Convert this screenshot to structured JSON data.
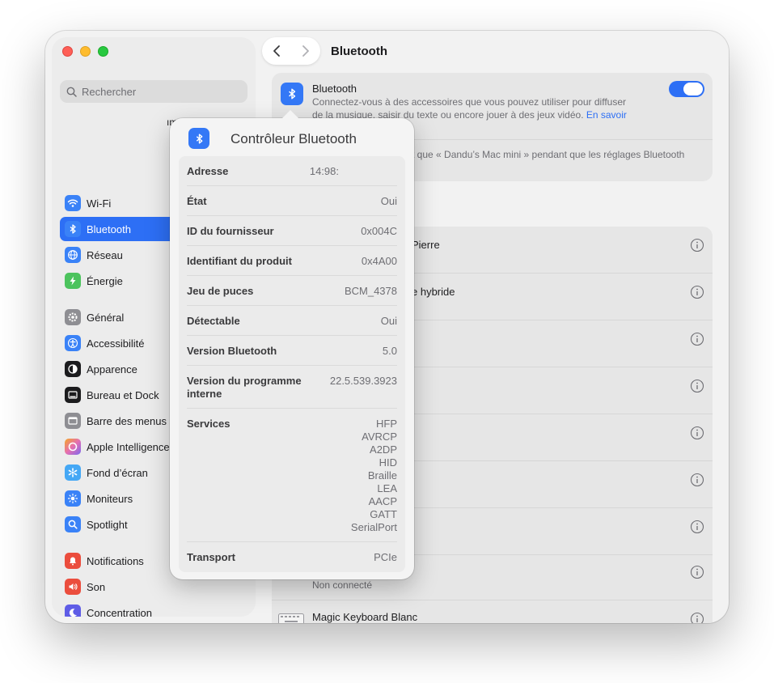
{
  "sidebar": {
    "search_placeholder": "Rechercher",
    "profile_fragment": "ım",
    "items": [
      {
        "label": "Wi-Fi",
        "icon": "wifi-icon",
        "color": "#3a82f7"
      },
      {
        "label": "Bluetooth",
        "icon": "bluetooth-icon",
        "color": "#3a82f7",
        "active": true
      },
      {
        "label": "Réseau",
        "icon": "globe-icon",
        "color": "#3a82f7"
      },
      {
        "label": "Énergie",
        "icon": "battery-bolt-icon",
        "color": "#4cc35d"
      },
      {
        "label": "Général",
        "icon": "gear-icon",
        "color": "#8e8e93"
      },
      {
        "label": "Accessibilité",
        "icon": "accessibility-icon",
        "color": "#3a82f7"
      },
      {
        "label": "Apparence",
        "icon": "appearance-icon",
        "color": "#1c1c1e"
      },
      {
        "label": "Bureau et Dock",
        "icon": "dock-icon",
        "color": "#1c1c1e"
      },
      {
        "label": "Barre des menus",
        "icon": "menubar-icon",
        "color": "#8e8e93"
      },
      {
        "label": "Apple Intelligence",
        "icon": "apple-intelligence-icon",
        "color": "#e56fb1"
      },
      {
        "label": "Fond d’écran",
        "icon": "wallpaper-icon",
        "color": "#45a8f5"
      },
      {
        "label": "Moniteurs",
        "icon": "sun-icon",
        "color": "#3a82f7"
      },
      {
        "label": "Spotlight",
        "icon": "spotlight-icon",
        "color": "#3a82f7"
      },
      {
        "label": "Notifications",
        "icon": "notifications-icon",
        "color": "#eb4d3d"
      },
      {
        "label": "Son",
        "icon": "speaker-icon",
        "color": "#eb4d3d"
      },
      {
        "label": "Concentration",
        "icon": "moon-icon",
        "color": "#5e5ce6"
      }
    ]
  },
  "main": {
    "title": "Bluetooth",
    "bluetooth": {
      "title": "Bluetooth",
      "description_line1": "Connectez-vous à des accessoires que vous pouvez utiliser pour diffuser",
      "description_line2": "de la musique, saisir du texte ou encore jouer à des jeux vidéo.",
      "learn_more": "En savoir",
      "visible_text": "t que « Dandu’s Mac mini » pendant que les réglages Bluetooth"
    },
    "devices": [
      {
        "name": "Pierre",
        "status": ""
      },
      {
        "name": "e hybride",
        "status": ""
      },
      {
        "name": "",
        "status": ""
      },
      {
        "name": "",
        "status": ""
      },
      {
        "name": "",
        "status": ""
      },
      {
        "name": "",
        "status": ""
      },
      {
        "name": "",
        "status": ""
      },
      {
        "name": "",
        "status": "Non connecté"
      },
      {
        "name": "Magic Keyboard Blanc",
        "status": ""
      }
    ]
  },
  "popover": {
    "title": "Contrôleur Bluetooth",
    "rows": [
      {
        "label": "Adresse",
        "value": "14:98:"
      },
      {
        "label": "État",
        "value": "Oui"
      },
      {
        "label": "ID du fournisseur",
        "value": "0x004C"
      },
      {
        "label": "Identifiant du produit",
        "value": "0x4A00"
      },
      {
        "label": "Jeu de puces",
        "value": "BCM_4378"
      },
      {
        "label": "Détectable",
        "value": "Oui"
      },
      {
        "label": "Version Bluetooth",
        "value": "5.0"
      },
      {
        "label": "Version du programme interne",
        "value": "22.5.539.3923"
      }
    ],
    "services_label": "Services",
    "services": [
      "HFP",
      "AVRCP",
      "A2DP",
      "HID",
      "Braille",
      "LEA",
      "AACP",
      "GATT",
      "SerialPort"
    ],
    "transport_label": "Transport",
    "transport_value": "PCIe"
  }
}
